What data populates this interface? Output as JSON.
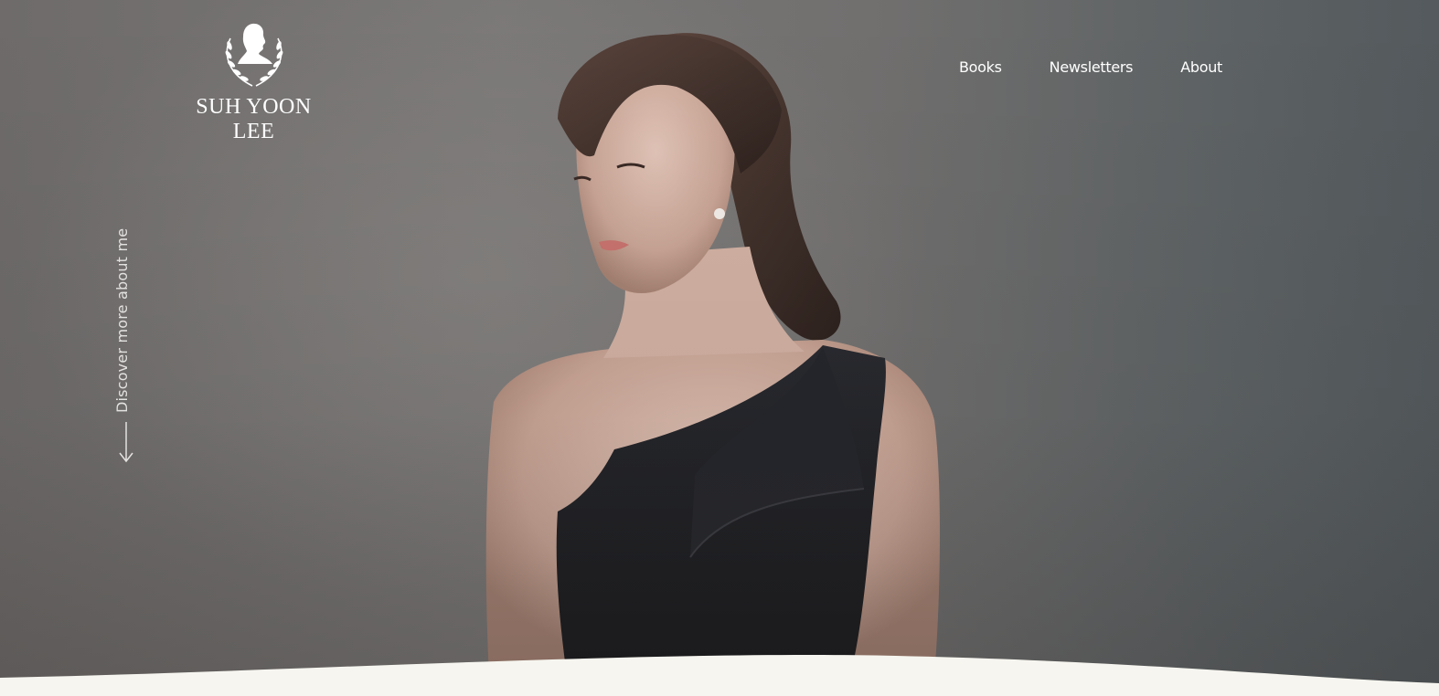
{
  "brand": {
    "name": "SUH YOON LEE",
    "logo_icon": "silhouette-laurel-icon"
  },
  "nav": {
    "items": [
      {
        "label": "Books"
      },
      {
        "label": "Newsletters"
      },
      {
        "label": "About"
      }
    ]
  },
  "hero": {
    "scroll_cta": "Discover more about me",
    "scroll_icon": "arrow-down-icon"
  },
  "colors": {
    "page_bg": "#f6f5ef",
    "nav_text": "#ffffff",
    "dress": "#1c1d21"
  }
}
